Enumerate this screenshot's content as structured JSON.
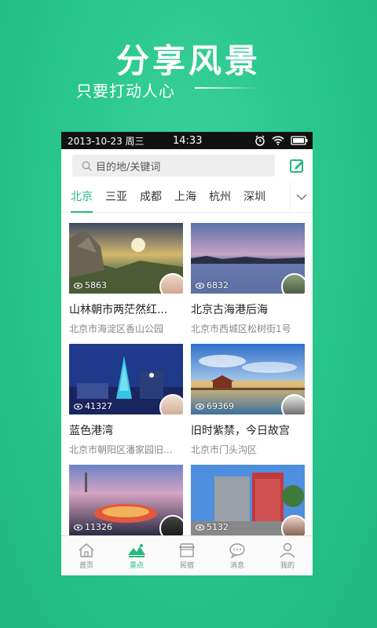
{
  "hero": {
    "title": "分享风景",
    "subtitle": "只要打动人心"
  },
  "status": {
    "date": "2013-10-23 周三",
    "time": "14:33"
  },
  "search": {
    "placeholder": "目的地/关键词"
  },
  "cities": [
    "北京",
    "三亚",
    "成都",
    "上海",
    "杭州",
    "深圳"
  ],
  "active_city": "北京",
  "cards": [
    {
      "title": "山林朝市两茫然红...",
      "address": "北京市海淀区香山公园",
      "views": "5863"
    },
    {
      "title": "北京古海港后海",
      "address": "北京市西城区松树街1号",
      "views": "6832"
    },
    {
      "title": "蓝色港湾",
      "address": "北京市朝阳区潘家园旧...",
      "views": "41327"
    },
    {
      "title": "旧时紫禁，今日故宫",
      "address": "北京市门头沟区",
      "views": "69369"
    },
    {
      "title": "",
      "address": "",
      "views": "11326"
    },
    {
      "title": "",
      "address": "",
      "views": "5132"
    }
  ],
  "tabs": [
    {
      "label": "首页",
      "icon": "home-icon"
    },
    {
      "label": "景点",
      "icon": "mountain-icon"
    },
    {
      "label": "民宿",
      "icon": "shop-icon"
    },
    {
      "label": "消息",
      "icon": "chat-icon"
    },
    {
      "label": "我的",
      "icon": "person-icon"
    }
  ],
  "active_tab": "景点",
  "colors": {
    "brand_green": "#27c48c",
    "accent": "#23b97e"
  }
}
